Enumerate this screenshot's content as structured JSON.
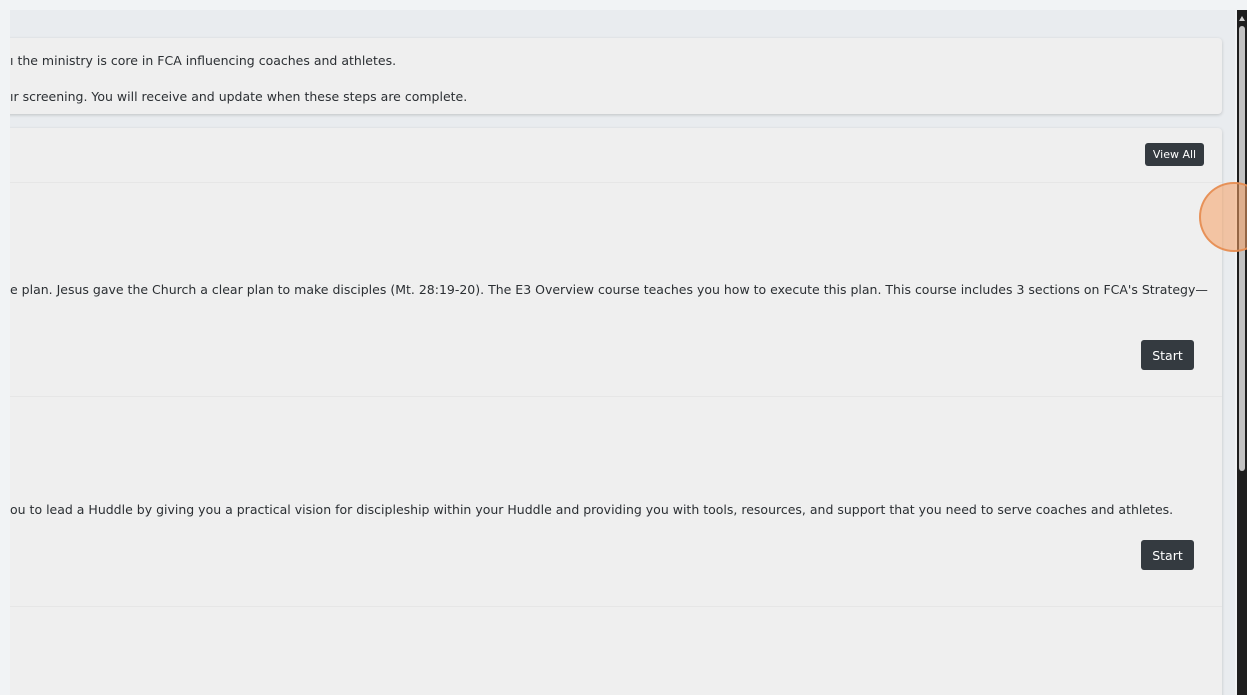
{
  "notice": {
    "line1": "ı the ministry is core in FCA influencing coaches and athletes.",
    "line2": "ır screening. You will receive and update when these steps are complete."
  },
  "courses": {
    "view_all_label": "View All",
    "items": [
      {
        "description": "e plan. Jesus gave the Church a clear plan to make disciples (Mt. 28:19-20). The E3 Overview course teaches you how to execute this plan. This course includes 3 sections on FCA's Strategy—",
        "button_label": "Start"
      },
      {
        "description": "ou to lead a Huddle by giving you a practical vision for discipleship within your Huddle and providing you with tools, resources, and support that you need to serve coaches and athletes.",
        "button_label": "Start"
      }
    ]
  },
  "colors": {
    "button_bg": "#343a40",
    "card_bg": "#efefef",
    "page_bg": "#e9ecef",
    "cursor_highlight": "#f5a064"
  }
}
